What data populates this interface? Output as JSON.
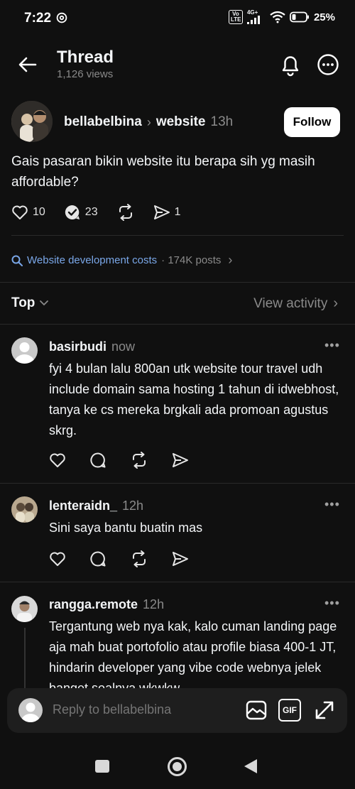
{
  "status_bar": {
    "time": "7:22",
    "network": "4G+",
    "volte": "Vo LTE",
    "battery": "25%"
  },
  "header": {
    "title": "Thread",
    "views": "1,126 views"
  },
  "post": {
    "author": "bellabelbina",
    "topic": "website",
    "time": "13h",
    "follow_label": "Follow",
    "text": "Gais pasaran bikin website itu berapa sih yg masih affordable?",
    "likes": "10",
    "replies": "23",
    "shares": "1"
  },
  "search_suggestion": {
    "query": "Website development costs",
    "count": "· 174K posts"
  },
  "sort": {
    "label": "Top",
    "view_activity": "View activity"
  },
  "replies": [
    {
      "user": "basirbudi",
      "time": "now",
      "text": "fyi 4 bulan lalu 800an utk website tour travel udh include domain sama hosting 1 tahun di idwebhost, tanya ke cs mereka brgkali ada promoan agustus skrg."
    },
    {
      "user": "lenteraidn_",
      "time": "12h",
      "text": "Sini saya bantu buatin mas"
    },
    {
      "user": "rangga.remote",
      "time": "12h",
      "text": "Tergantung web nya kak, kalo cuman landing page aja mah buat portofolio atau profile biasa 400-1 JT, hindarin developer yang vibe code webnya jelek banget soalnya wkwkw"
    }
  ],
  "reply_bar": {
    "placeholder": "Reply to bellabelbina",
    "gif_label": "GIF"
  },
  "colors": {
    "background": "#101010",
    "link": "#7aa7e8",
    "muted": "#8a8a8a"
  }
}
